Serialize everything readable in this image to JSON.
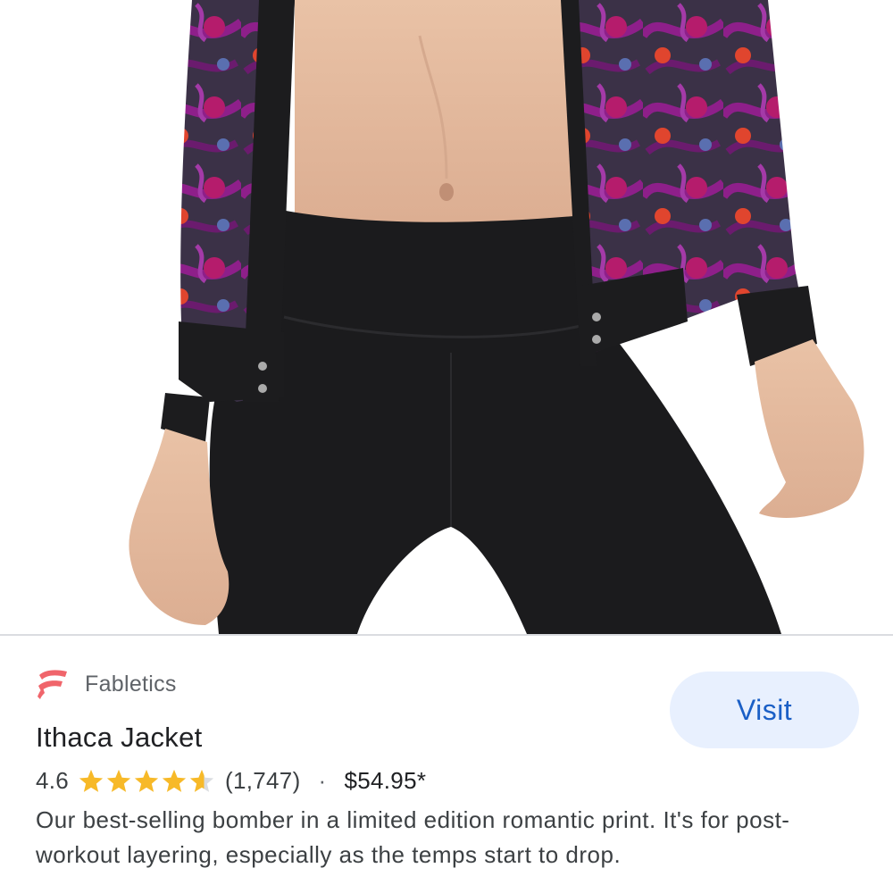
{
  "merchant": {
    "name": "Fabletics",
    "logo_icon": "fabletics-logo-icon",
    "logo_color": "#f0656b"
  },
  "product": {
    "title": "Ithaca Jacket",
    "rating": "4.6",
    "rating_stars": 4.6,
    "review_count": "(1,747)",
    "separator": "·",
    "price": "$54.95*",
    "description": "Our best-selling bomber in a limited edition romantic print. It's for post-workout layering, especially as the temps start to drop."
  },
  "actions": {
    "visit_label": "Visit"
  },
  "colors": {
    "visit_bg": "#e8f0fe",
    "visit_text": "#1a5fc6",
    "star": "#f7b928",
    "star_empty": "#dadce0"
  }
}
